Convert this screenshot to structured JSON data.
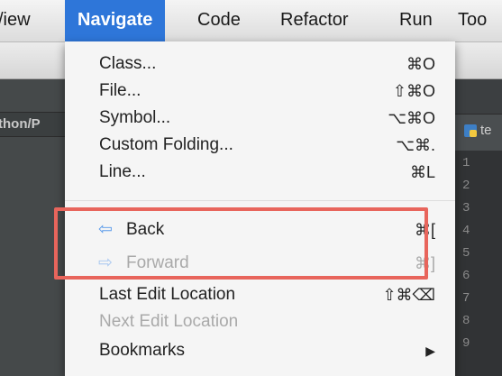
{
  "menubar": {
    "items": [
      "/iew",
      "Navigate",
      "Code",
      "Refactor",
      "Run",
      "Too"
    ]
  },
  "ide": {
    "left_path": "thon/P",
    "tab_label": "te",
    "line_numbers": [
      "1",
      "2",
      "3",
      "4",
      "5",
      "6",
      "7",
      "8",
      "9"
    ]
  },
  "menu": {
    "items": [
      {
        "label": "Class...",
        "shortcut": "⌘O",
        "enabled": true
      },
      {
        "label": "File...",
        "shortcut": "⇧⌘O",
        "enabled": true
      },
      {
        "label": "Symbol...",
        "shortcut": "⌥⌘O",
        "enabled": true
      },
      {
        "label": "Custom Folding...",
        "shortcut": "⌥⌘.",
        "enabled": true
      },
      {
        "label": "Line...",
        "shortcut": "⌘L",
        "enabled": true
      },
      {
        "label": "Back",
        "shortcut": "⌘[",
        "enabled": true,
        "icon": "arrow-left-icon"
      },
      {
        "label": "Forward",
        "shortcut": "⌘]",
        "enabled": false,
        "icon": "arrow-right-icon"
      },
      {
        "label": "Last Edit Location",
        "shortcut": "⇧⌘⌫",
        "enabled": true
      },
      {
        "label": "Next Edit Location",
        "shortcut": "",
        "enabled": false
      },
      {
        "label": "Bookmarks",
        "shortcut": "▶",
        "enabled": true
      }
    ]
  },
  "colors": {
    "accent": "#2e76d9",
    "highlight_border": "#e8655c",
    "arrow_blue": "#5b9bea"
  }
}
